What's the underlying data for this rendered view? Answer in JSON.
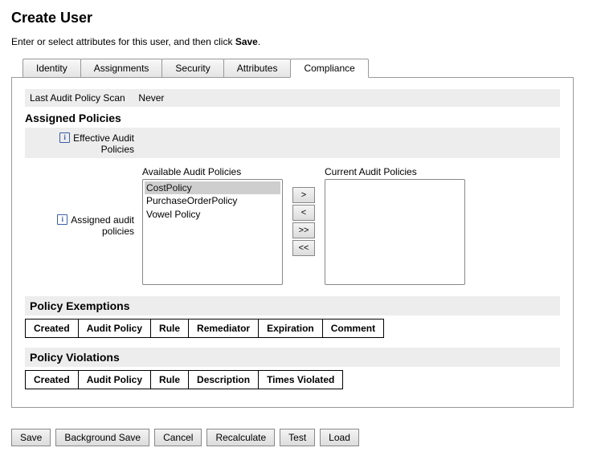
{
  "page_title": "Create User",
  "instruction_prefix": "Enter or select attributes for this user, and then click ",
  "instruction_bold": "Save",
  "instruction_suffix": ".",
  "tabs": {
    "identity": "Identity",
    "assignments": "Assignments",
    "security": "Security",
    "attributes": "Attributes",
    "compliance": "Compliance"
  },
  "active_tab": "compliance",
  "last_scan_label": "Last Audit Policy Scan",
  "last_scan_value": "Never",
  "assigned_policies_heading": "Assigned Policies",
  "effective_label_line1": "Effective Audit",
  "effective_label_line2": "Policies",
  "assigned_label_line1": "Assigned audit",
  "assigned_label_line2": "policies",
  "available_label": "Available Audit Policies",
  "current_label": "Current Audit Policies",
  "available_policies": [
    "CostPolicy",
    "PurchaseOrderPolicy",
    "Vowel Policy"
  ],
  "current_policies": [],
  "move_buttons": {
    "add": ">",
    "remove": "<",
    "add_all": ">>",
    "remove_all": "<<"
  },
  "exemptions_heading": "Policy Exemptions",
  "exemptions_cols": [
    "Created",
    "Audit Policy",
    "Rule",
    "Remediator",
    "Expiration",
    "Comment"
  ],
  "violations_heading": "Policy Violations",
  "violations_cols": [
    "Created",
    "Audit Policy",
    "Rule",
    "Description",
    "Times Violated"
  ],
  "buttons": {
    "save": "Save",
    "bg_save": "Background Save",
    "cancel": "Cancel",
    "recalculate": "Recalculate",
    "test": "Test",
    "load": "Load"
  }
}
